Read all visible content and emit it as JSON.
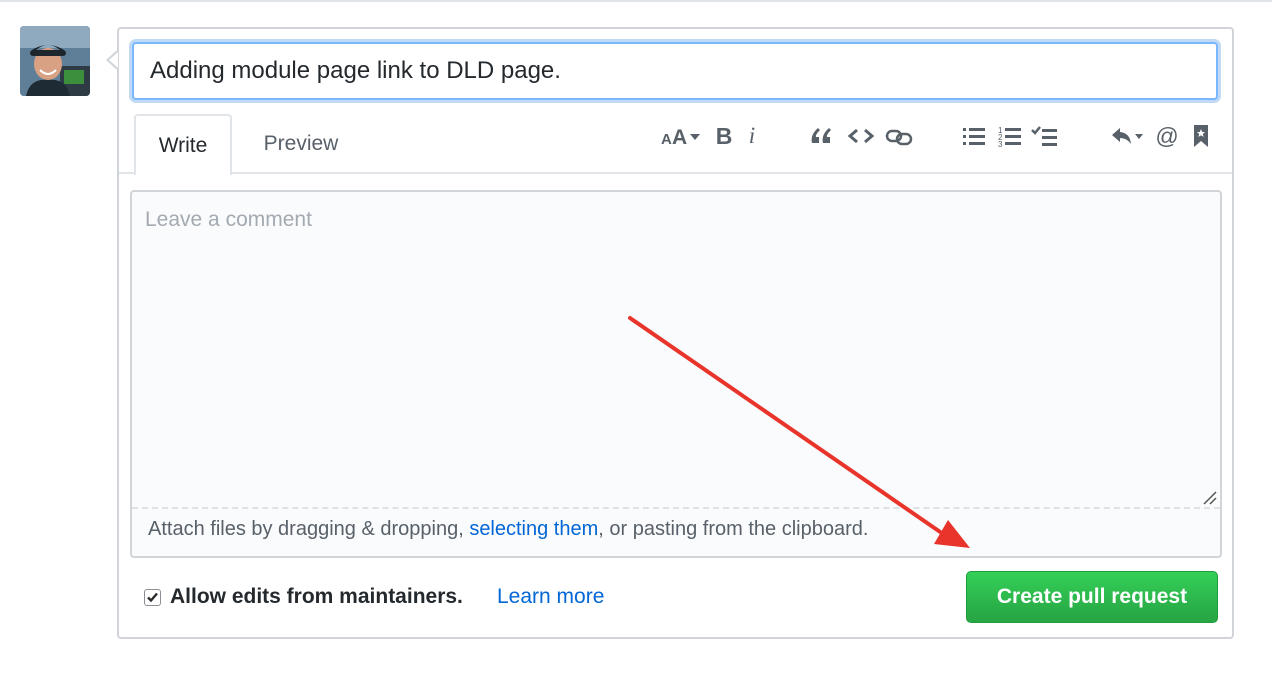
{
  "pr_form": {
    "title_value": "Adding module page link to DLD page.",
    "tabs": [
      {
        "label": "Write"
      },
      {
        "label": "Preview"
      }
    ],
    "toolbar": {
      "icons": [
        "text-size-icon",
        "bold-icon",
        "italic-icon",
        "quote-icon",
        "code-icon",
        "link-icon",
        "bulleted-list-icon",
        "numbered-list-icon",
        "task-list-icon",
        "reply-icon",
        "mention-icon",
        "bookmark-icon"
      ],
      "bold_glyph": "B",
      "italic_glyph": "i",
      "mention_glyph": "@"
    },
    "comment": {
      "placeholder": "Leave a comment",
      "value": ""
    },
    "attach": {
      "prefix": "Attach files by dragging & dropping, ",
      "link": "selecting them",
      "suffix": ", or pasting from the clipboard."
    },
    "allow_edits": {
      "checked": true,
      "label": "Allow edits from maintainers.",
      "learn_more": "Learn more"
    },
    "submit_label": "Create pull request"
  },
  "colors": {
    "accent_blue": "#0366d6",
    "button_green": "#28a745",
    "annotation_red": "#e8342a",
    "focus_border": "#79b8ff"
  }
}
